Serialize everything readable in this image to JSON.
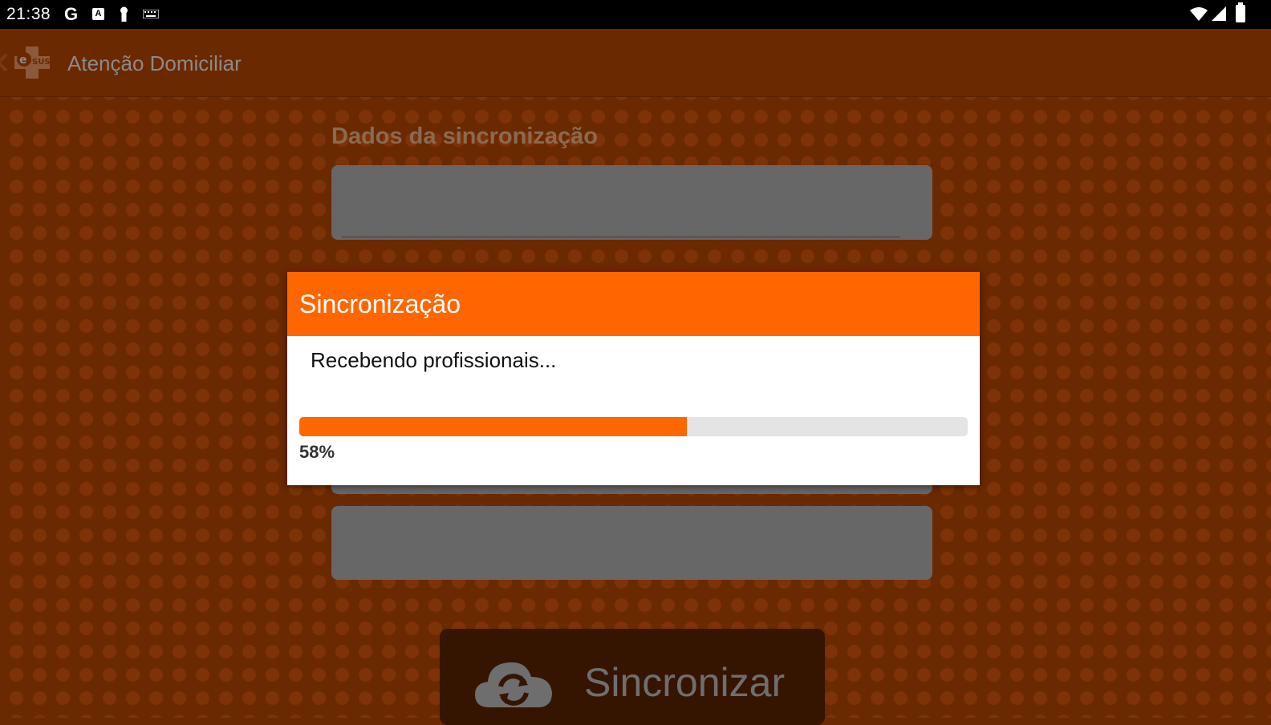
{
  "status_bar": {
    "time": "21:38",
    "icons": [
      "google-icon",
      "a-badge-icon",
      "keyhole-icon",
      "keyboard-icon",
      "wifi-icon",
      "signal-icon",
      "battery-charging-icon"
    ],
    "g_label": "G",
    "a_label": "A"
  },
  "app_bar": {
    "title": "Atenção Domiciliar",
    "logo": "esus-logo-icon",
    "back_icon": "back-arrow-icon"
  },
  "main": {
    "section_title": "Dados da sincronização",
    "sync_button_label": "Sincronizar",
    "sync_button_icon": "cloud-sync-icon"
  },
  "dialog": {
    "title": "Sincronização",
    "message": "Recebendo profissionais...",
    "progress_percent": 58,
    "progress_text": "58%"
  },
  "colors": {
    "accent": "#ff6600",
    "background": "#6b2900",
    "field": "#676767",
    "button_bg": "#351500"
  }
}
